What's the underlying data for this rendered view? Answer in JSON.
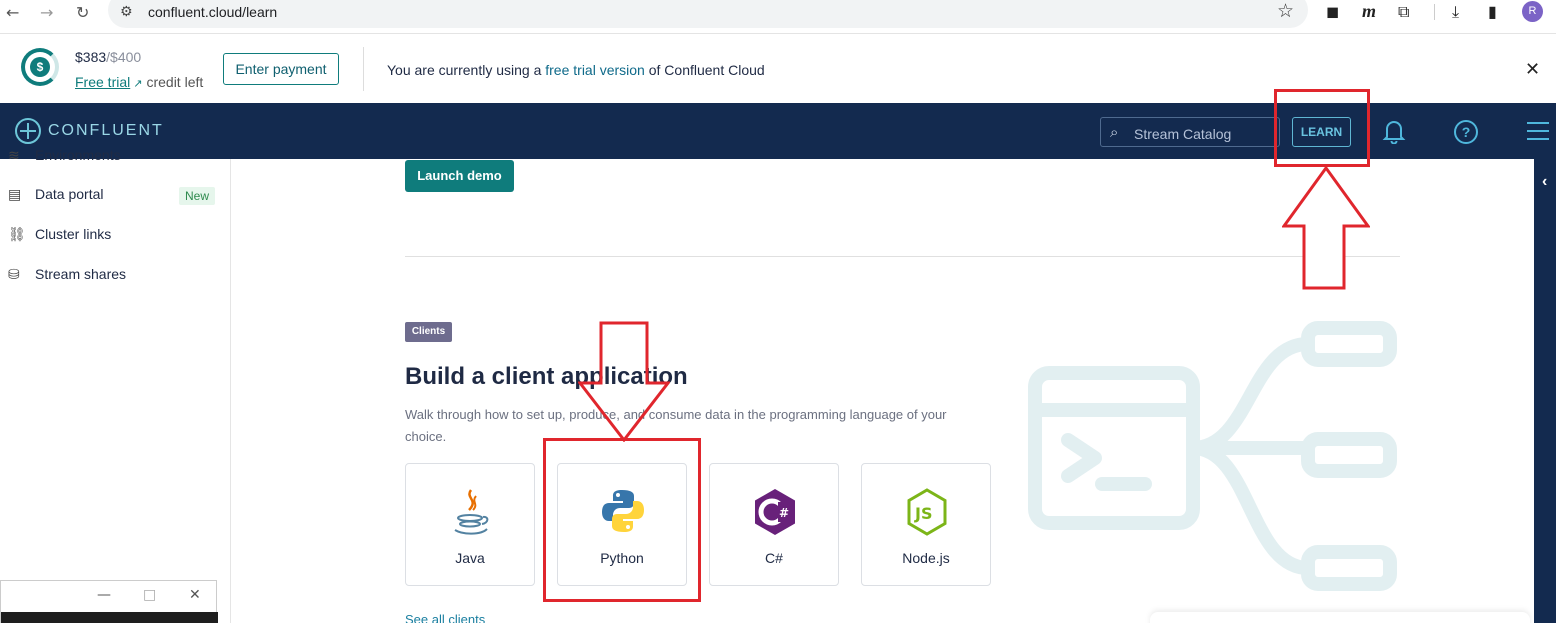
{
  "browser": {
    "url": "confluent.cloud/learn",
    "profile_initial": "R"
  },
  "banner": {
    "credit_used": "$383",
    "credit_total": "/$400",
    "trial_link": "Free trial",
    "credit_left": "credit left",
    "enter_payment": "Enter payment",
    "msg_prefix": "You are currently using a ",
    "msg_highlight": "free trial version",
    "msg_suffix": " of Confluent Cloud"
  },
  "header": {
    "logo_text": "CONFLUENT",
    "search_placeholder": "Stream Catalog",
    "learn_label": "LEARN"
  },
  "sidebar": {
    "items": [
      {
        "label": "Environments",
        "icon": "layers-icon"
      },
      {
        "label": "Data portal",
        "icon": "document-icon",
        "badge": "New"
      },
      {
        "label": "Cluster links",
        "icon": "link-icon"
      },
      {
        "label": "Stream shares",
        "icon": "database-icon"
      }
    ]
  },
  "main": {
    "launch_demo": "Launch demo",
    "clients_tag": "Clients",
    "section_title": "Build a client application",
    "section_desc": "Walk through how to set up, produce, and consume data in the programming language of your choice.",
    "clients": [
      {
        "label": "Java",
        "icon": "java-icon"
      },
      {
        "label": "Python",
        "icon": "python-icon"
      },
      {
        "label": "C#",
        "icon": "csharp-icon"
      },
      {
        "label": "Node.js",
        "icon": "nodejs-icon"
      }
    ],
    "see_all": "See all clients"
  },
  "colors": {
    "navy": "#132a4f",
    "teal": "#0f7c7c",
    "annotation_red": "#e0262d"
  }
}
